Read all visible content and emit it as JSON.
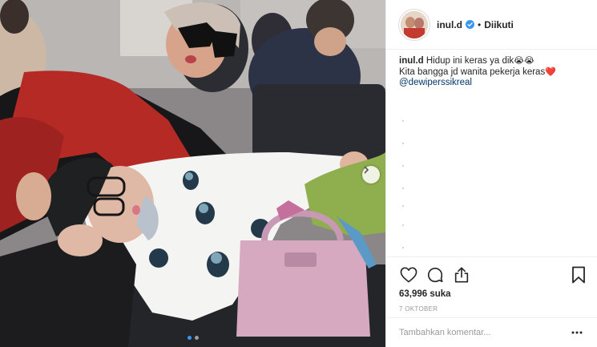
{
  "header": {
    "username": "inul.d",
    "separator": "•",
    "follow_status": "Diikuti",
    "verified_icon": "verified-badge-icon"
  },
  "caption": {
    "username": "inul.d",
    "line1": "Hidup ini keras ya dik",
    "line1_emoji": "😭😭",
    "line2": "Kita bangga jd wanita pekerja keras",
    "line2_emoji": "❤️",
    "mention": "@dewiperssikreal"
  },
  "actions": {
    "like_icon": "heart-icon",
    "comment_icon": "comment-bubble-icon",
    "share_icon": "share-icon",
    "save_icon": "bookmark-icon"
  },
  "likes": "63,996 suka",
  "date": "7 OKTOBER",
  "comment_box": {
    "placeholder": "Tambahkan komentar...",
    "more_icon": "more-dots-icon"
  },
  "carousel": {
    "next_icon": "chevron-right-icon",
    "page_count": 2,
    "active_index": 1
  },
  "colors": {
    "mention": "#003569",
    "verified": "#3897f0",
    "muted": "#999999",
    "border": "#efefef"
  }
}
